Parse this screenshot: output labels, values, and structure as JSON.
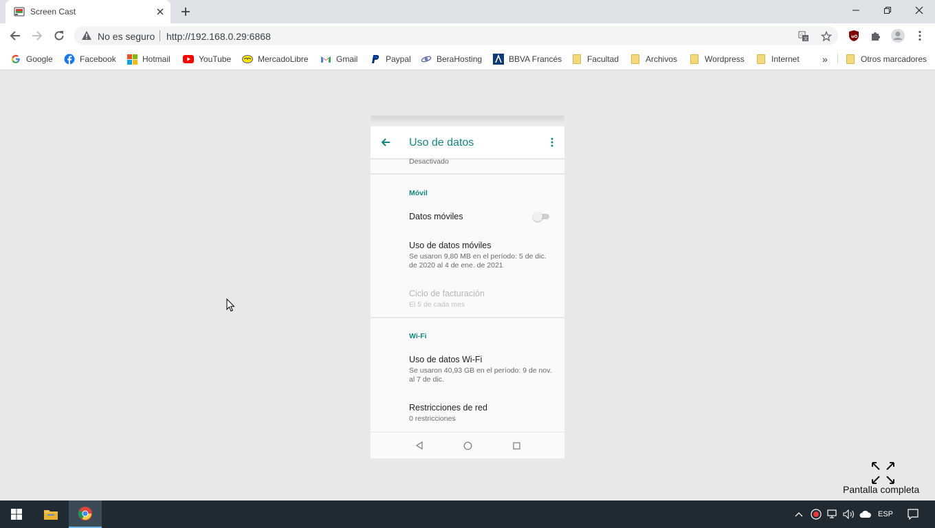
{
  "browser": {
    "tab": {
      "title": "Screen Cast",
      "favicon": "screencast-icon"
    },
    "window_controls": [
      "minimize-icon",
      "restore-icon",
      "close-icon"
    ],
    "security_label": "No es seguro",
    "url": "http://192.168.0.29:6868",
    "bookmarks": [
      {
        "label": "Google",
        "icon": "google-icon"
      },
      {
        "label": "Facebook",
        "icon": "facebook-icon"
      },
      {
        "label": "Hotmail",
        "icon": "hotmail-icon"
      },
      {
        "label": "YouTube",
        "icon": "youtube-icon"
      },
      {
        "label": "MercadoLibre",
        "icon": "mercadolibre-icon"
      },
      {
        "label": "Gmail",
        "icon": "gmail-icon"
      },
      {
        "label": "Paypal",
        "icon": "paypal-icon"
      },
      {
        "label": "BeraHosting",
        "icon": "berahosting-icon"
      },
      {
        "label": "BBVA Francés",
        "icon": "bbva-icon"
      },
      {
        "label": "Facultad",
        "icon": "folder-icon"
      },
      {
        "label": "Archivos",
        "icon": "folder-icon"
      },
      {
        "label": "Wordpress",
        "icon": "folder-icon"
      },
      {
        "label": "Internet",
        "icon": "folder-icon"
      }
    ],
    "overflow_label": "»",
    "other_bookmarks": "Otros marcadores"
  },
  "phone": {
    "appbar_title": "Uso de datos",
    "top_summary": "Desactivado",
    "sections": {
      "mobile": {
        "header": "Móvil",
        "mobile_data": {
          "label": "Datos móviles",
          "enabled": false
        },
        "mobile_usage": {
          "title": "Uso de datos móviles",
          "line1": "Se usaron 9,80 MB en el período: 5 de dic.",
          "line2": "de 2020 al 4 de ene. de 2021"
        },
        "billing_cycle": {
          "title": "Ciclo de facturación",
          "subtitle": "El 5 de cada mes"
        }
      },
      "wifi": {
        "header": "Wi-Fi",
        "wifi_usage": {
          "title": "Uso de datos Wi-Fi",
          "line1": "Se usaron 40,93 GB en el período: 9 de nov.",
          "line2": "al 7 de dic."
        },
        "restrictions": {
          "title": "Restricciones de red",
          "subtitle": "0 restricciones"
        }
      }
    }
  },
  "fullscreen": {
    "label": "Pantalla completa"
  },
  "taskbar": {
    "language": "ESP"
  },
  "colors": {
    "accent": "#12877f",
    "page_bg": "#e8e8e8",
    "taskbar": "#1f2a33"
  }
}
